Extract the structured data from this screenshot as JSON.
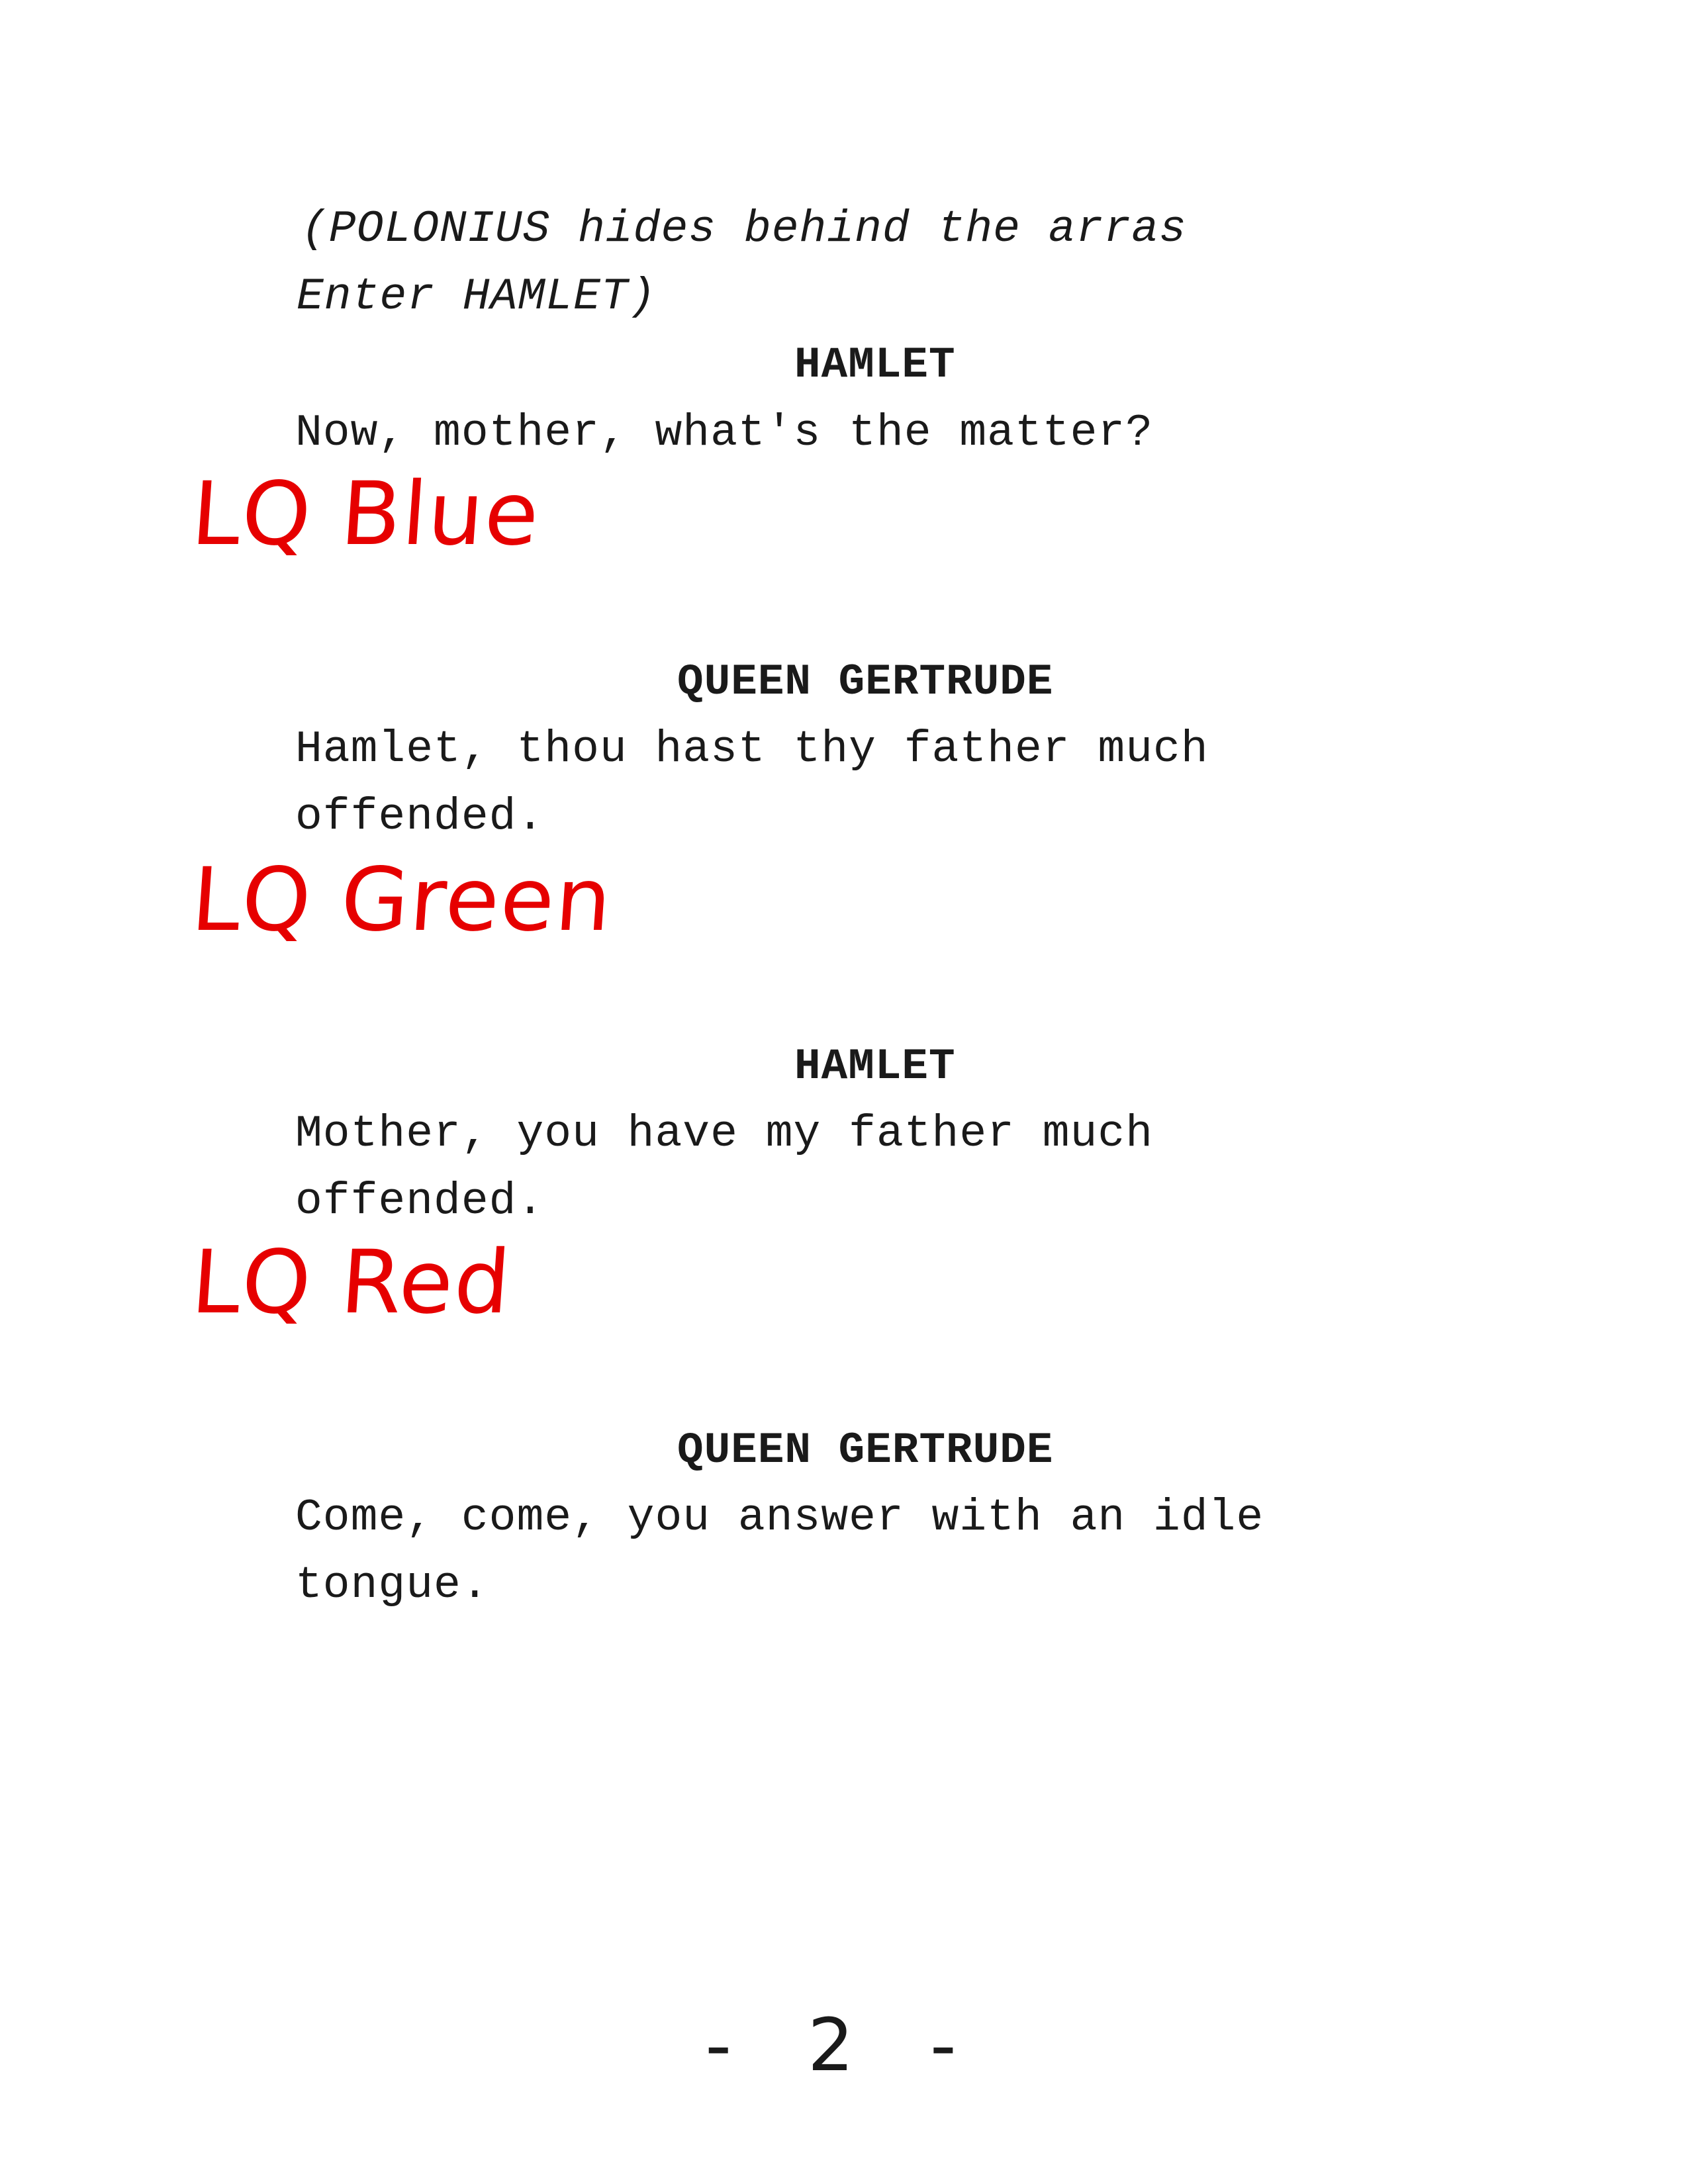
{
  "script": {
    "stage_direction": {
      "line1": "(POLONIUS hides behind the arras",
      "line2": "Enter HAMLET)"
    },
    "blocks": [
      {
        "character": "HAMLET",
        "lines": [
          "Now, mother, what's the matter?"
        ],
        "cue": "LQ Blue"
      },
      {
        "character": "QUEEN GERTRUDE",
        "lines": [
          "Hamlet, thou hast thy father much",
          "offended."
        ],
        "cue": "LQ Green"
      },
      {
        "character": "HAMLET",
        "lines": [
          "Mother, you have my father much",
          "offended."
        ],
        "cue": "LQ Red"
      },
      {
        "character": "QUEEN GERTRUDE",
        "lines": [
          "Come, come, you answer with an idle",
          "tongue."
        ]
      }
    ]
  },
  "footer": {
    "page_number": "- 2 -"
  },
  "colors": {
    "cue_annotation": "#e60000",
    "text": "#1a1a1a",
    "background": "#ffffff"
  }
}
